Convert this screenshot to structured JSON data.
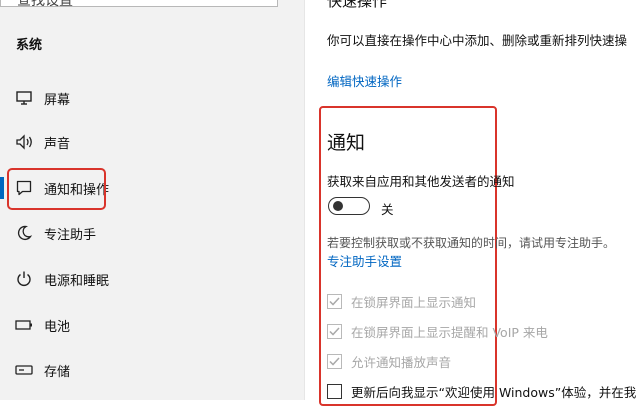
{
  "sidebar": {
    "top_text": "查找设置",
    "section_title": "系统",
    "items": [
      {
        "label": "屏幕",
        "icon": "monitor-icon",
        "selected": false
      },
      {
        "label": "声音",
        "icon": "speaker-icon",
        "selected": false
      },
      {
        "label": "通知和操作",
        "icon": "notification-icon",
        "selected": true
      },
      {
        "label": "专注助手",
        "icon": "moon-icon",
        "selected": false
      },
      {
        "label": "电源和睡眠",
        "icon": "power-icon",
        "selected": false
      },
      {
        "label": "电池",
        "icon": "battery-icon",
        "selected": false
      },
      {
        "label": "存储",
        "icon": "storage-icon",
        "selected": false
      }
    ]
  },
  "quick_actions": {
    "title": "快速操作",
    "description": "你可以直接在操作中心中添加、删除或重新排列快速操",
    "edit_link": "编辑快速操作"
  },
  "notifications": {
    "title": "通知",
    "subtitle": "获取来自应用和其他发送者的通知",
    "toggle_state": "关",
    "toggle_on": false,
    "focus_description": "若要控制获取或不获取通知的时间，请试用专注助手。",
    "focus_link": "专注助手设置",
    "options": [
      {
        "label": "在锁屏界面上显示通知",
        "checked": true,
        "disabled": true
      },
      {
        "label": "在锁屏界面上显示提醒和 VoIP 来电",
        "checked": true,
        "disabled": true
      },
      {
        "label": "允许通知播放声音",
        "checked": true,
        "disabled": true
      },
      {
        "label": "更新后向我显示“欢迎使用 Windows”体验，并在我",
        "checked": false,
        "disabled": false
      }
    ]
  },
  "colors": {
    "accent": "#0067c0",
    "link": "#0066c2",
    "highlight_box": "#d9342b",
    "sidebar_bg": "#f2f2f2"
  }
}
